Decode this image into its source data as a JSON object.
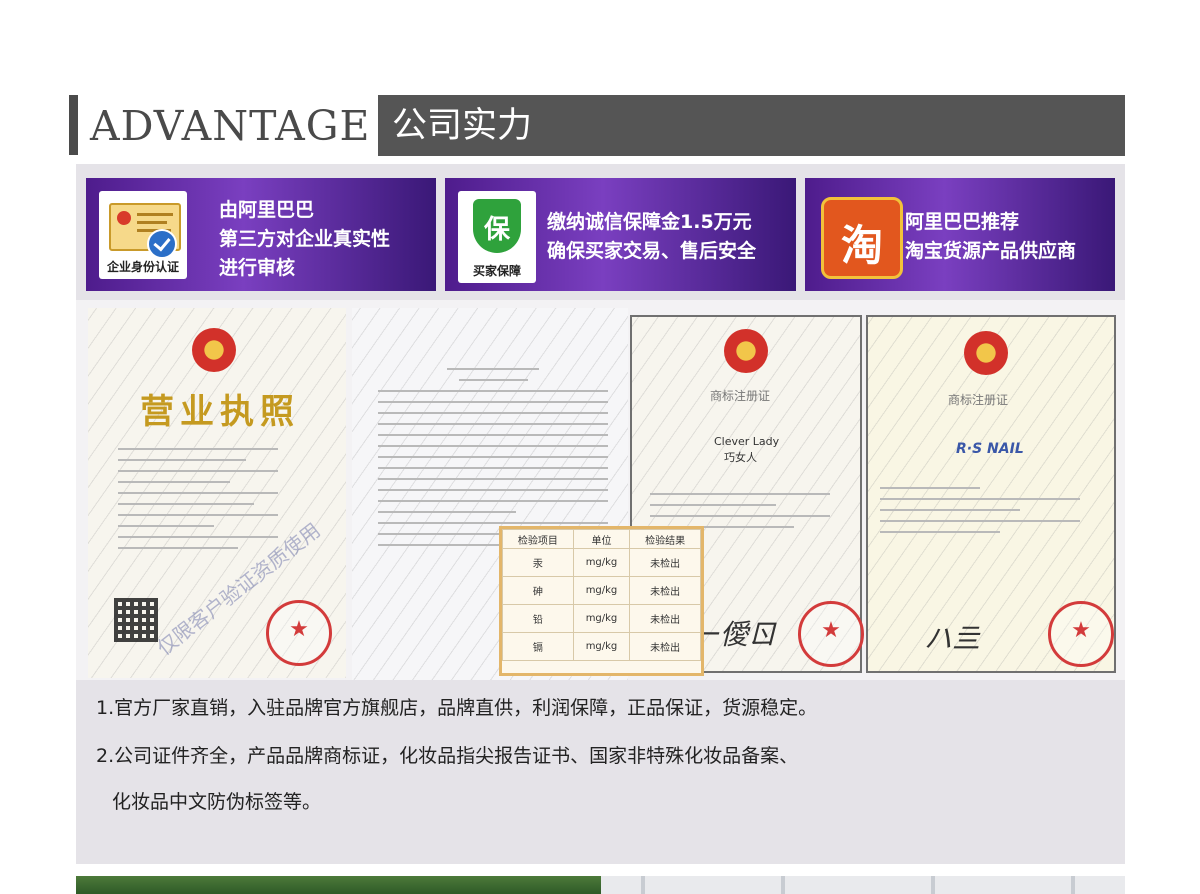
{
  "header": {
    "title_en": "ADVANTAGE",
    "title_cn": "公司实力"
  },
  "features": [
    {
      "badge_icon": "enterprise-id-icon",
      "badge_caption": "企业身份认证",
      "lines": [
        "由阿里巴巴",
        "第三方对企业真实性",
        "进行审核"
      ]
    },
    {
      "badge_icon": "buyer-protection-shield-icon",
      "badge_glyph": "保",
      "badge_caption": "买家保障",
      "lines": [
        "缴纳诚信保障金1.5万元",
        "确保买家交易、售后安全"
      ]
    },
    {
      "badge_icon": "taobao-icon",
      "badge_glyph": "淘",
      "lines": [
        "阿里巴巴推荐",
        "淘宝货源产品供应商"
      ]
    }
  ],
  "certificates": {
    "business_license": {
      "title": "营业执照",
      "watermark": "仅限客户验证资质使用"
    },
    "trademark_1": {
      "title": "商标注册证",
      "brand": "Clever Lady",
      "brand_cn": "巧女人"
    },
    "trademark_2": {
      "title": "商标注册证",
      "brand": "R·S NAIL"
    },
    "inspection_table": {
      "headers": [
        "检验项目",
        "单位",
        "检验结果"
      ],
      "rows": [
        [
          "汞",
          "mg/kg",
          "未检出"
        ],
        [
          "砷",
          "mg/kg",
          "未检出"
        ],
        [
          "铅",
          "mg/kg",
          "未检出"
        ],
        [
          "镉",
          "mg/kg",
          "未检出"
        ]
      ]
    }
  },
  "description": [
    "1.官方厂家直销，入驻品牌官方旗舰店，品牌直供，利润保障，正品保证，货源稳定。",
    "2.公司证件齐全，产品品牌商标证，化妆品指尖报告证书、国家非特殊化妆品备案、",
    "化妆品中文防伪标签等。"
  ],
  "colors": {
    "header_bar": "#555555",
    "card_purple": "#6a32b0",
    "panel_grey": "#e5e3e8",
    "license_gold": "#c59a20",
    "seal_red": "#d33b3b"
  }
}
